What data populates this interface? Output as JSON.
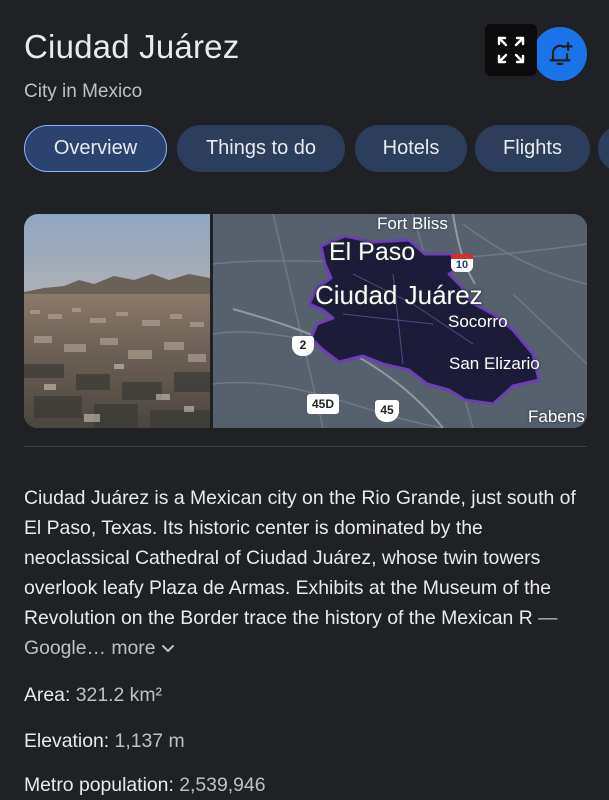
{
  "header": {
    "title": "Ciudad Juárez",
    "subtitle": "City in Mexico",
    "more_icon": "more-vert-icon",
    "follow_icon": "bell-plus-icon"
  },
  "tabs": [
    {
      "label": "Overview",
      "active": true
    },
    {
      "label": "Things to do",
      "active": false
    },
    {
      "label": "Hotels",
      "active": false
    },
    {
      "label": "Flights",
      "active": false
    }
  ],
  "map": {
    "labels": {
      "fort_bliss": "Fort Bliss",
      "el_paso": "El Paso",
      "ciudad_juarez": "Ciudad Juárez",
      "socorro": "Socorro",
      "san_elizario": "San Elizario",
      "fabens": "Fabens"
    },
    "road_shields": {
      "i10": "10",
      "mx2": "2",
      "mx45d": "45D",
      "mx45": "45"
    },
    "expand_icon": "fullscreen-icon"
  },
  "description": {
    "text": "Ciudad Juárez is a Mexican city on the Rio Grande, just south of El Paso, Texas. Its historic center is dominated by the neoclassical Cathedral of Ciudad Juárez, whose twin towers overlook leafy Plaza de Armas. Exhibits at the Museum of the Revolution on the Border trace the history of the Mexican R",
    "source": " — Google…",
    "more_label": "more"
  },
  "facts": [
    {
      "label": "Area:",
      "value": " 321.2 km²"
    },
    {
      "label": "Elevation:",
      "value": " 1,137 m"
    },
    {
      "label": "Metro population:",
      "value": " 2,539,946"
    }
  ],
  "colors": {
    "background": "#202124",
    "accent_blue": "#1a73e8",
    "tab_bg": "#2d3e5c",
    "map_region": "#1c1b3a",
    "map_border": "#6d3fb4"
  }
}
